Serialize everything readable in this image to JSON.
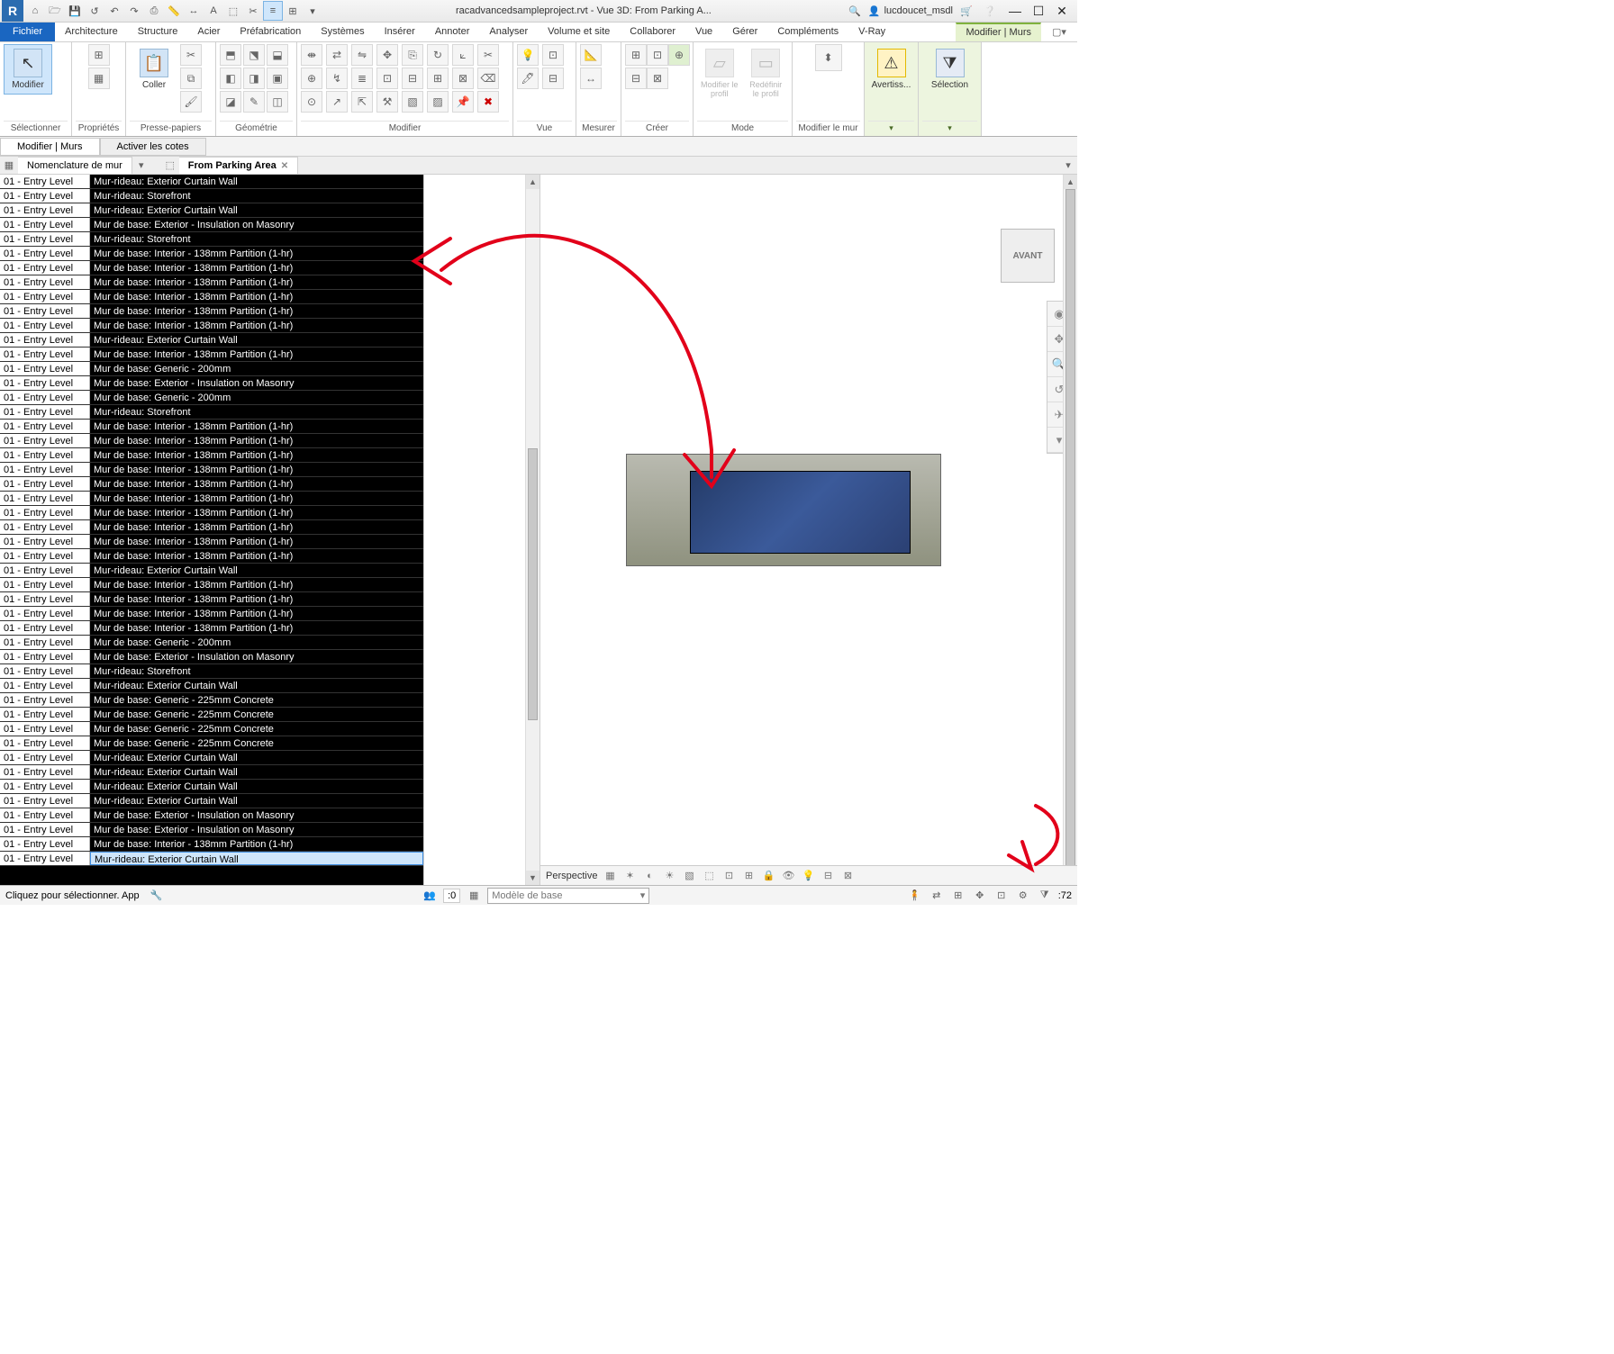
{
  "titlebar": {
    "title": "racadvancedsampleproject.rvt - Vue 3D: From Parking A...",
    "search_placeholder": "",
    "user": "lucdoucet_msdl"
  },
  "ribbon_tabs": {
    "file": "Fichier",
    "tabs": [
      "Architecture",
      "Structure",
      "Acier",
      "Préfabrication",
      "Systèmes",
      "Insérer",
      "Annoter",
      "Analyser",
      "Volume et site",
      "Collaborer",
      "Vue",
      "Gérer",
      "Compléments",
      "V-Ray"
    ],
    "ctx": "Modifier | Murs"
  },
  "panels": {
    "selectionner": {
      "title": "Sélectionner",
      "btn": "Modifier"
    },
    "proprietes": {
      "title": "Propriétés"
    },
    "presse": {
      "title": "Presse-papiers",
      "btn": "Coller"
    },
    "geometrie": {
      "title": "Géométrie"
    },
    "modifier": {
      "title": "Modifier"
    },
    "vue": {
      "title": "Vue"
    },
    "mesurer": {
      "title": "Mesurer"
    },
    "creer": {
      "title": "Créer"
    },
    "mode": {
      "title": "Mode",
      "b1": "Modifier le profil",
      "b2": "Redéfinir le profil"
    },
    "mur": {
      "title": "Modifier le mur"
    },
    "avert": {
      "title": "Avertiss..."
    },
    "selection2": {
      "title": "Sélection"
    }
  },
  "subribbon": {
    "t1": "Modifier | Murs",
    "t2": "Activer les cotes"
  },
  "pane_tabs": {
    "left": "Nomenclature de mur",
    "right": "From Parking Area"
  },
  "schedule": {
    "col1_label": "01 - Entry Level",
    "rows": [
      "Mur-rideau: Exterior Curtain Wall",
      "Mur-rideau: Storefront",
      "Mur-rideau: Exterior Curtain Wall",
      "Mur de base: Exterior - Insulation on Masonry",
      "Mur-rideau: Storefront",
      "Mur de base: Interior - 138mm Partition (1-hr)",
      "Mur de base: Interior - 138mm Partition (1-hr)",
      "Mur de base: Interior - 138mm Partition (1-hr)",
      "Mur de base: Interior - 138mm Partition (1-hr)",
      "Mur de base: Interior - 138mm Partition (1-hr)",
      "Mur de base: Interior - 138mm Partition (1-hr)",
      "Mur-rideau: Exterior Curtain Wall",
      "Mur de base: Interior - 138mm Partition (1-hr)",
      "Mur de base: Generic - 200mm",
      "Mur de base: Exterior - Insulation on Masonry",
      "Mur de base: Generic - 200mm",
      "Mur-rideau: Storefront",
      "Mur de base: Interior - 138mm Partition (1-hr)",
      "Mur de base: Interior - 138mm Partition (1-hr)",
      "Mur de base: Interior - 138mm Partition (1-hr)",
      "Mur de base: Interior - 138mm Partition (1-hr)",
      "Mur de base: Interior - 138mm Partition (1-hr)",
      "Mur de base: Interior - 138mm Partition (1-hr)",
      "Mur de base: Interior - 138mm Partition (1-hr)",
      "Mur de base: Interior - 138mm Partition (1-hr)",
      "Mur de base: Interior - 138mm Partition (1-hr)",
      "Mur de base: Interior - 138mm Partition (1-hr)",
      "Mur-rideau: Exterior Curtain Wall",
      "Mur de base: Interior - 138mm Partition (1-hr)",
      "Mur de base: Interior - 138mm Partition (1-hr)",
      "Mur de base: Interior - 138mm Partition (1-hr)",
      "Mur de base: Interior - 138mm Partition (1-hr)",
      "Mur de base: Generic - 200mm",
      "Mur de base: Exterior - Insulation on Masonry",
      "Mur-rideau: Storefront",
      "Mur-rideau: Exterior Curtain Wall",
      "Mur de base: Generic - 225mm Concrete",
      "Mur de base: Generic - 225mm Concrete",
      "Mur de base: Generic - 225mm Concrete",
      "Mur de base: Generic - 225mm Concrete",
      "Mur-rideau: Exterior Curtain Wall",
      "Mur-rideau: Exterior Curtain Wall",
      "Mur-rideau: Exterior Curtain Wall",
      "Mur-rideau: Exterior Curtain Wall",
      "Mur de base: Exterior - Insulation on Masonry",
      "Mur de base: Exterior - Insulation on Masonry",
      "Mur de base: Interior - 138mm Partition (1-hr)",
      "Mur-rideau: Exterior Curtain Wall"
    ],
    "selected_index": 47
  },
  "navcube": "AVANT",
  "viewctrl": {
    "mode": "Perspective"
  },
  "status": {
    "msg": "Cliquez pour sélectionner. App",
    "worksets": ":0",
    "combo": "Modèle de base",
    "filter": ":72"
  }
}
